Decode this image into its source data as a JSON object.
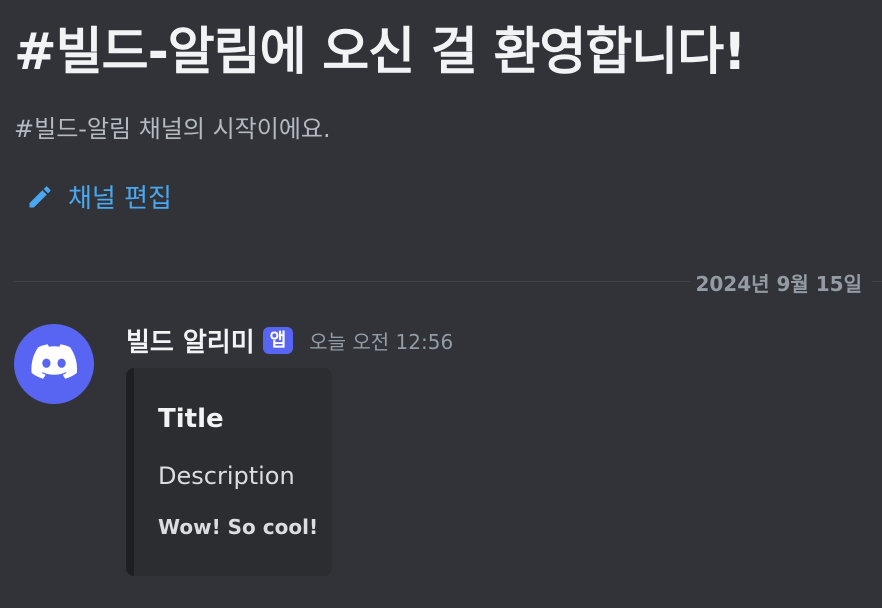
{
  "welcome": {
    "title": "#빌드-알림에 오신 걸 환영합니다!",
    "subtitle": "#빌드-알림 채널의 시작이에요.",
    "edit_label": "채널 편집",
    "edit_icon": "pencil-icon"
  },
  "divider": {
    "date": "2024년 9월 15일"
  },
  "message": {
    "avatar_icon": "discord-logo-icon",
    "username": "빌드 알리미",
    "badge": "앱",
    "timestamp": "오늘 오전 12:56",
    "embed": {
      "title": "Title",
      "description": "Description",
      "text": "Wow! So cool!"
    }
  },
  "colors": {
    "background": "#313338",
    "link": "#4aa8f0",
    "blurple": "#5865f2",
    "embed_background": "#2b2d31",
    "embed_border": "#1e1f22"
  }
}
